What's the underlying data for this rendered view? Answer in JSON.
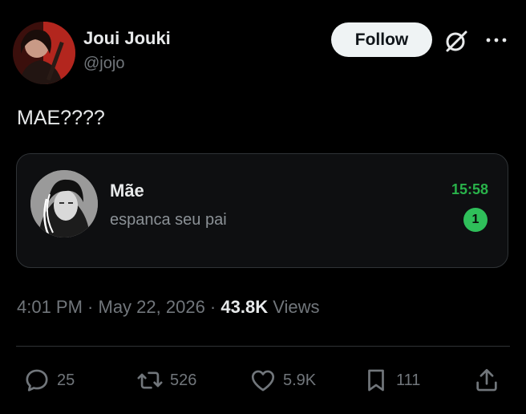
{
  "author": {
    "display_name": "Joui Jouki",
    "handle": "@jojo"
  },
  "header": {
    "follow_label": "Follow",
    "grok_icon": "grok-icon",
    "more_icon": "more-icon"
  },
  "tweet": {
    "text": "MAE????"
  },
  "embedded_chat": {
    "contact_name": "Mãe",
    "message": "espanca seu pai",
    "time": "15:58",
    "unread_count": "1",
    "accent_color": "#29b24a"
  },
  "meta": {
    "time": "4:01 PM",
    "sep1": " · ",
    "date": "May 22, 2026",
    "sep2": " · ",
    "views_count": "43.8K",
    "views_label": "Views"
  },
  "actions": {
    "replies": "25",
    "reposts": "526",
    "likes": "5.9K",
    "bookmarks": "111"
  },
  "colors": {
    "background": "#000000",
    "text_primary": "#e7e9ea",
    "text_secondary": "#71767b",
    "follow_bg": "#eff3f4"
  }
}
